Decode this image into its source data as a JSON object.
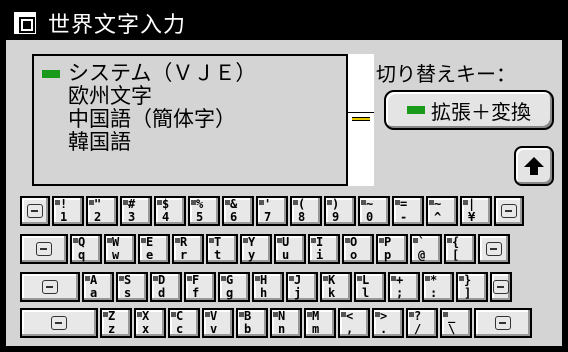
{
  "window": {
    "title": "世界文字入力"
  },
  "status": {
    "lines": [
      "システム（ＶＪＥ）",
      "欧州文字",
      "中国語（簡体字）",
      "韓国語"
    ]
  },
  "switch": {
    "label": "切り替えキー：",
    "button_label": "拡張＋変換"
  },
  "keyboard": {
    "row1": [
      [
        "1",
        "!"
      ],
      [
        "2",
        "\""
      ],
      [
        "3",
        "#"
      ],
      [
        "4",
        "$"
      ],
      [
        "5",
        "%"
      ],
      [
        "6",
        "&"
      ],
      [
        "7",
        "'"
      ],
      [
        "8",
        "("
      ],
      [
        "9",
        ")"
      ],
      [
        "0",
        "~"
      ],
      [
        "-",
        "="
      ],
      [
        "^",
        "~"
      ],
      [
        "¥",
        "|"
      ]
    ],
    "row2": [
      [
        "q",
        "Q"
      ],
      [
        "w",
        "W"
      ],
      [
        "e",
        "E"
      ],
      [
        "r",
        "R"
      ],
      [
        "t",
        "T"
      ],
      [
        "y",
        "Y"
      ],
      [
        "u",
        "U"
      ],
      [
        "i",
        "I"
      ],
      [
        "o",
        "O"
      ],
      [
        "p",
        "P"
      ],
      [
        "@",
        "`"
      ],
      [
        "[",
        "{"
      ]
    ],
    "row3": [
      [
        "a",
        "A"
      ],
      [
        "s",
        "S"
      ],
      [
        "d",
        "D"
      ],
      [
        "f",
        "F"
      ],
      [
        "g",
        "G"
      ],
      [
        "h",
        "H"
      ],
      [
        "j",
        "J"
      ],
      [
        "k",
        "K"
      ],
      [
        "l",
        "L"
      ],
      [
        ";",
        "+"
      ],
      [
        ":",
        "*"
      ],
      [
        "]",
        "}"
      ]
    ],
    "row4": [
      [
        "z",
        "Z"
      ],
      [
        "x",
        "X"
      ],
      [
        "c",
        "C"
      ],
      [
        "v",
        "V"
      ],
      [
        "b",
        "B"
      ],
      [
        "n",
        "N"
      ],
      [
        "m",
        "M"
      ],
      [
        ",",
        "<"
      ],
      [
        ".",
        ">"
      ],
      [
        "/",
        "?"
      ],
      [
        "\\",
        "_"
      ]
    ]
  },
  "colors": {
    "indicator": "#1a9a1a",
    "thumb": "#e6c800"
  }
}
